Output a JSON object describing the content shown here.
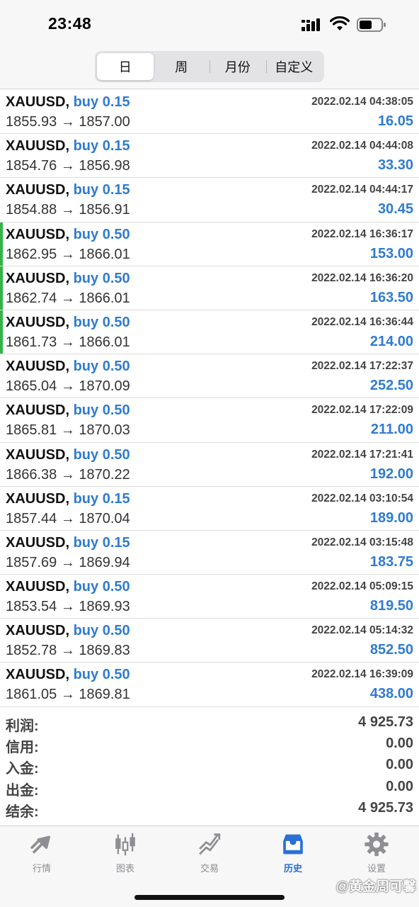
{
  "status": {
    "time": "23:48"
  },
  "segments": [
    "日",
    "周",
    "月份",
    "自定义"
  ],
  "active_segment": "日",
  "trades": [
    {
      "symbol": "XAUUSD,",
      "side": "buy 0.15",
      "time": "2022.02.14 04:38:05",
      "prices": "1855.93 → 1857.00",
      "profit": "16.05",
      "marked": false
    },
    {
      "symbol": "XAUUSD,",
      "side": "buy 0.15",
      "time": "2022.02.14 04:44:08",
      "prices": "1854.76 → 1856.98",
      "profit": "33.30",
      "marked": false
    },
    {
      "symbol": "XAUUSD,",
      "side": "buy 0.15",
      "time": "2022.02.14 04:44:17",
      "prices": "1854.88 → 1856.91",
      "profit": "30.45",
      "marked": false
    },
    {
      "symbol": "XAUUSD,",
      "side": "buy 0.50",
      "time": "2022.02.14 16:36:17",
      "prices": "1862.95 → 1866.01",
      "profit": "153.00",
      "marked": true
    },
    {
      "symbol": "XAUUSD,",
      "side": "buy 0.50",
      "time": "2022.02.14 16:36:20",
      "prices": "1862.74 → 1866.01",
      "profit": "163.50",
      "marked": true
    },
    {
      "symbol": "XAUUSD,",
      "side": "buy 0.50",
      "time": "2022.02.14 16:36:44",
      "prices": "1861.73 → 1866.01",
      "profit": "214.00",
      "marked": true
    },
    {
      "symbol": "XAUUSD,",
      "side": "buy 0.50",
      "time": "2022.02.14 17:22:37",
      "prices": "1865.04 → 1870.09",
      "profit": "252.50",
      "marked": false
    },
    {
      "symbol": "XAUUSD,",
      "side": "buy 0.50",
      "time": "2022.02.14 17:22:09",
      "prices": "1865.81 → 1870.03",
      "profit": "211.00",
      "marked": false
    },
    {
      "symbol": "XAUUSD,",
      "side": "buy 0.50",
      "time": "2022.02.14 17:21:41",
      "prices": "1866.38 → 1870.22",
      "profit": "192.00",
      "marked": false
    },
    {
      "symbol": "XAUUSD,",
      "side": "buy 0.15",
      "time": "2022.02.14 03:10:54",
      "prices": "1857.44 → 1870.04",
      "profit": "189.00",
      "marked": false
    },
    {
      "symbol": "XAUUSD,",
      "side": "buy 0.15",
      "time": "2022.02.14 03:15:48",
      "prices": "1857.69 → 1869.94",
      "profit": "183.75",
      "marked": false
    },
    {
      "symbol": "XAUUSD,",
      "side": "buy 0.50",
      "time": "2022.02.14 05:09:15",
      "prices": "1853.54 → 1869.93",
      "profit": "819.50",
      "marked": false
    },
    {
      "symbol": "XAUUSD,",
      "side": "buy 0.50",
      "time": "2022.02.14 05:14:32",
      "prices": "1852.78 → 1869.83",
      "profit": "852.50",
      "marked": false
    },
    {
      "symbol": "XAUUSD,",
      "side": "buy 0.50",
      "time": "2022.02.14 16:39:09",
      "prices": "1861.05 → 1869.81",
      "profit": "438.00",
      "marked": false
    }
  ],
  "summary": [
    {
      "label": "利润:",
      "value": "4 925.73"
    },
    {
      "label": "信用:",
      "value": "0.00"
    },
    {
      "label": "入金:",
      "value": "0.00"
    },
    {
      "label": "出金:",
      "value": "0.00"
    },
    {
      "label": "结余:",
      "value": "4 925.73"
    }
  ],
  "tabs": [
    {
      "label": "行情",
      "icon": "quotes-icon"
    },
    {
      "label": "图表",
      "icon": "chart-icon"
    },
    {
      "label": "交易",
      "icon": "trade-icon"
    },
    {
      "label": "历史",
      "icon": "history-icon"
    },
    {
      "label": "设置",
      "icon": "settings-icon"
    }
  ],
  "active_tab": "历史",
  "watermark": "@黄金周可馨",
  "colors": {
    "accent": "#2f7bd1",
    "marker": "#35b34a",
    "tab_inactive": "#8e8e93",
    "tab_active": "#2a6fd6"
  }
}
